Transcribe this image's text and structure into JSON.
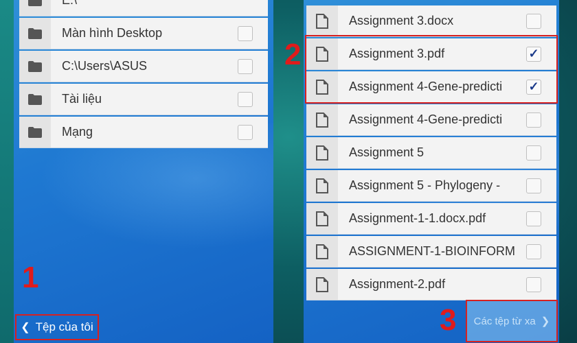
{
  "left_panel": {
    "items": [
      {
        "label": "E:\\",
        "checked": false
      },
      {
        "label": "Màn hình Desktop",
        "checked": false
      },
      {
        "label": "C:\\Users\\ASUS",
        "checked": false
      },
      {
        "label": "Tài liệu",
        "checked": false
      },
      {
        "label": "Mạng",
        "checked": false
      }
    ],
    "back_button": {
      "label": "Tệp của tôi",
      "icon": "chevron-left-icon"
    }
  },
  "right_panel": {
    "items": [
      {
        "label": "Assignment 3.docx",
        "checked": false
      },
      {
        "label": "Assignment 3.pdf",
        "checked": true
      },
      {
        "label": "Assignment 4-Gene-predicti",
        "checked": true
      },
      {
        "label": "Assignment 4-Gene-predicti",
        "checked": false
      },
      {
        "label": "Assignment 5",
        "checked": false
      },
      {
        "label": "Assignment 5 - Phylogeny -",
        "checked": false
      },
      {
        "label": "Assignment-1-1.docx.pdf",
        "checked": false
      },
      {
        "label": "ASSIGNMENT-1-BIOINFORM",
        "checked": false
      },
      {
        "label": "Assignment-2.pdf",
        "checked": false
      }
    ],
    "forward_button": {
      "label": "Các tệp từ xa",
      "icon": "chevron-right-icon"
    }
  },
  "annotations": {
    "step1": "1",
    "step2": "2",
    "step3": "3"
  },
  "colors": {
    "panel_blue": "#1f79d2",
    "highlight_red": "#d8201f",
    "check_blue": "#1b3a8a"
  },
  "checkmark": "✓"
}
